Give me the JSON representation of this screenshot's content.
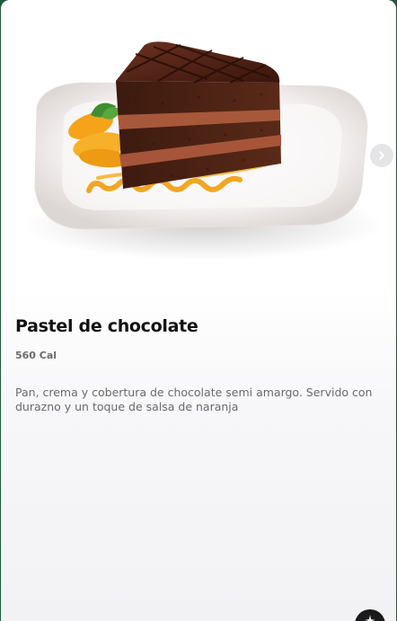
{
  "product": {
    "name": "Pastel de chocolate",
    "calories": "560 Cal",
    "description": "Pan, crema y cobertura de chocolate semi amargo. Servido con durazno y un toque de salsa de naranja"
  },
  "gallery": {
    "image": "chocolate-cake-slice-photo",
    "next_icon": "chevron-right-icon"
  },
  "fab": {
    "icon": "sparkle-icon"
  },
  "colors": {
    "background": "#1f5a3a",
    "title": "#111111",
    "text_muted": "#6a6a6a"
  }
}
